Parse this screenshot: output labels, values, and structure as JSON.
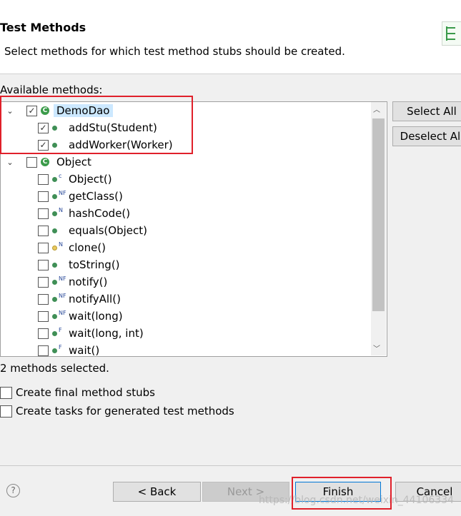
{
  "header": {
    "title": "Test Methods",
    "description": "Select methods for which test method stubs should be created."
  },
  "available_label": "Available methods:",
  "tree": [
    {
      "type": "class",
      "label": "DemoDao",
      "checked": true,
      "selected": true
    },
    {
      "type": "method",
      "label": "addStu(Student)",
      "checked": true,
      "mod": ""
    },
    {
      "type": "method",
      "label": "addWorker(Worker)",
      "checked": true,
      "mod": ""
    },
    {
      "type": "class",
      "label": "Object",
      "checked": false
    },
    {
      "type": "method",
      "label": "Object()",
      "checked": false,
      "mod": "c"
    },
    {
      "type": "method",
      "label": "getClass()",
      "checked": false,
      "mod": "NF"
    },
    {
      "type": "method",
      "label": "hashCode()",
      "checked": false,
      "mod": "N"
    },
    {
      "type": "method",
      "label": "equals(Object)",
      "checked": false,
      "mod": ""
    },
    {
      "type": "method",
      "label": "clone()",
      "checked": false,
      "mod": "N",
      "protected": true
    },
    {
      "type": "method",
      "label": "toString()",
      "checked": false,
      "mod": ""
    },
    {
      "type": "method",
      "label": "notify()",
      "checked": false,
      "mod": "NF"
    },
    {
      "type": "method",
      "label": "notifyAll()",
      "checked": false,
      "mod": "NF"
    },
    {
      "type": "method",
      "label": "wait(long)",
      "checked": false,
      "mod": "NF"
    },
    {
      "type": "method",
      "label": "wait(long, int)",
      "checked": false,
      "mod": "F"
    },
    {
      "type": "method",
      "label": "wait()",
      "checked": false,
      "mod": "F"
    }
  ],
  "buttons": {
    "select_all": "Select All",
    "deselect_all": "Deselect All",
    "back": "< Back",
    "next": "Next >",
    "finish": "Finish",
    "cancel": "Cancel"
  },
  "status": "2 methods selected.",
  "options": [
    {
      "label": "Create final method stubs",
      "checked": false
    },
    {
      "label": "Create tasks for generated test methods",
      "checked": false
    }
  ],
  "watermark": "https://blog.csdn.net/weixin_44106334",
  "colors": {
    "highlight": "#e0202a",
    "selection": "#cce8ff"
  }
}
